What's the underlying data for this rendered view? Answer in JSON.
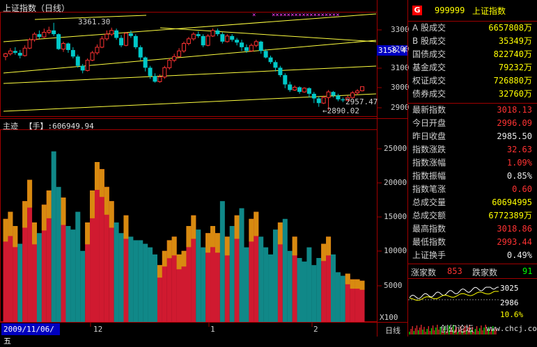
{
  "colors": {
    "up": "#ff3232",
    "down": "#00c8c8",
    "vol_up": "#d01a30",
    "vol_down": "#108888",
    "vol_top": "#d88a10",
    "grid": "#a00000",
    "trend": "#ffff40",
    "marker": "#ff40ff"
  },
  "header": {
    "title": "上证指数（日线）",
    "max_label": "3361.30",
    "current_price": "3158.4",
    "hi_label": "2957.47",
    "lo_label": "←2890.02"
  },
  "volume": {
    "title": "主迹",
    "unit": "【手】",
    "value": ":606949.94",
    "multiplier": "X100"
  },
  "axis": {
    "price_ticks": [
      "3300",
      "3200",
      "3100",
      "3000",
      "2900"
    ],
    "volume_ticks": [
      "25000",
      "20000",
      "15000",
      "10000",
      "5000"
    ],
    "date_label": "2009/11/06/五",
    "month_labels": [
      "12",
      "1",
      "2"
    ],
    "period": "日线"
  },
  "panel": {
    "icon": "G",
    "code": "999999",
    "name": "上证指数",
    "rows1": [
      {
        "label": "A 股成交",
        "value": "6657808万"
      },
      {
        "label": "B 股成交",
        "value": "35349万"
      },
      {
        "label": "国债成交",
        "value": "822740万"
      },
      {
        "label": "基金成交",
        "value": "79232万"
      },
      {
        "label": "权证成交",
        "value": "726880万"
      },
      {
        "label": "债券成交",
        "value": "32760万"
      }
    ],
    "rows2": [
      {
        "label": "最新指数",
        "value": "3018.13",
        "color": "red"
      },
      {
        "label": "今日开盘",
        "value": "2996.09",
        "color": "red"
      },
      {
        "label": "昨日收盘",
        "value": "2985.50",
        "color": "white"
      },
      {
        "label": "指数涨跌",
        "value": "32.63",
        "color": "red"
      },
      {
        "label": "指数涨幅",
        "value": "1.09%",
        "color": "red"
      },
      {
        "label": "指数振幅",
        "value": "0.85%",
        "color": "white"
      },
      {
        "label": "指数笔涨",
        "value": "0.60",
        "color": "red"
      },
      {
        "label": "总成交量",
        "value": "60694995",
        "color": "yellow"
      },
      {
        "label": "总成交额",
        "value": "6772389万",
        "color": "yellow"
      },
      {
        "label": "最高指数",
        "value": "3018.86",
        "color": "red"
      },
      {
        "label": "最低指数",
        "value": "2993.44",
        "color": "red"
      },
      {
        "label": "上证换手",
        "value": "0.49%",
        "color": "white"
      }
    ],
    "up_label": "涨家数",
    "up_count": "853",
    "down_label": "跌家数",
    "down_count": "91",
    "mini_hi": "3025",
    "mini_mid": "2986",
    "mini_pct": "10.6%",
    "watermark": "创幻论坛",
    "site": "www.chcj.com"
  },
  "chart_data": {
    "type": "candlestick",
    "title": "上证指数（日线）",
    "price_ylim": [
      2860,
      3420
    ],
    "volume_ylim": [
      0,
      27000
    ],
    "candles": [
      [
        3180,
        3195,
        3160,
        3200
      ],
      [
        3195,
        3210,
        3185,
        3225
      ],
      [
        3210,
        3200,
        3190,
        3230
      ],
      [
        3200,
        3185,
        3170,
        3215
      ],
      [
        3185,
        3225,
        3180,
        3240
      ],
      [
        3225,
        3270,
        3220,
        3280
      ],
      [
        3270,
        3300,
        3260,
        3310
      ],
      [
        3300,
        3285,
        3275,
        3320
      ],
      [
        3285,
        3310,
        3280,
        3330
      ],
      [
        3310,
        3320,
        3300,
        3340
      ],
      [
        3320,
        3300,
        3290,
        3361
      ],
      [
        3300,
        3220,
        3215,
        3305
      ],
      [
        3220,
        3250,
        3205,
        3260
      ],
      [
        3250,
        3215,
        3200,
        3255
      ],
      [
        3215,
        3180,
        3170,
        3230
      ],
      [
        3180,
        3130,
        3120,
        3190
      ],
      [
        3130,
        3105,
        3090,
        3140
      ],
      [
        3105,
        3160,
        3100,
        3170
      ],
      [
        3160,
        3200,
        3155,
        3210
      ],
      [
        3200,
        3230,
        3190,
        3245
      ],
      [
        3230,
        3275,
        3225,
        3290
      ],
      [
        3275,
        3300,
        3265,
        3320
      ],
      [
        3300,
        3320,
        3290,
        3335
      ],
      [
        3320,
        3280,
        3270,
        3330
      ],
      [
        3280,
        3240,
        3230,
        3295
      ],
      [
        3240,
        3305,
        3235,
        3310
      ],
      [
        3305,
        3290,
        3280,
        3320
      ],
      [
        3290,
        3230,
        3220,
        3300
      ],
      [
        3230,
        3175,
        3160,
        3240
      ],
      [
        3175,
        3120,
        3100,
        3180
      ],
      [
        3120,
        3075,
        3060,
        3130
      ],
      [
        3075,
        3045,
        3040,
        3090
      ],
      [
        3045,
        3070,
        3040,
        3085
      ],
      [
        3070,
        3120,
        3060,
        3130
      ],
      [
        3120,
        3160,
        3110,
        3170
      ],
      [
        3160,
        3180,
        3150,
        3195
      ],
      [
        3180,
        3210,
        3175,
        3225
      ],
      [
        3210,
        3250,
        3200,
        3260
      ],
      [
        3250,
        3275,
        3240,
        3285
      ],
      [
        3275,
        3300,
        3265,
        3310
      ],
      [
        3300,
        3290,
        3280,
        3315
      ],
      [
        3290,
        3240,
        3230,
        3300
      ],
      [
        3240,
        3290,
        3235,
        3300
      ],
      [
        3290,
        3320,
        3285,
        3330
      ],
      [
        3320,
        3300,
        3290,
        3330
      ],
      [
        3300,
        3260,
        3250,
        3310
      ],
      [
        3260,
        3290,
        3255,
        3300
      ],
      [
        3290,
        3270,
        3260,
        3300
      ],
      [
        3270,
        3255,
        3240,
        3280
      ],
      [
        3255,
        3230,
        3210,
        3270
      ],
      [
        3230,
        3210,
        3200,
        3245
      ],
      [
        3210,
        3240,
        3205,
        3250
      ],
      [
        3240,
        3260,
        3230,
        3270
      ],
      [
        3260,
        3210,
        3195,
        3265
      ],
      [
        3210,
        3175,
        3170,
        3220
      ],
      [
        3175,
        3150,
        3140,
        3185
      ],
      [
        3150,
        3120,
        3100,
        3160
      ],
      [
        3120,
        3080,
        3070,
        3130
      ],
      [
        3080,
        3030,
        3010,
        3090
      ],
      [
        3030,
        3000,
        2990,
        3045
      ],
      [
        3000,
        3015,
        2995,
        3025
      ],
      [
        3015,
        2990,
        2980,
        3020
      ],
      [
        2990,
        3010,
        2985,
        3015
      ],
      [
        3010,
        2980,
        2960,
        3015
      ],
      [
        2980,
        2955,
        2930,
        2990
      ],
      [
        2955,
        2930,
        2910,
        2965
      ],
      [
        2930,
        2960,
        2925,
        2970
      ],
      [
        2960,
        2990,
        2890,
        3000
      ],
      [
        2990,
        2970,
        2960,
        2995
      ],
      [
        2970,
        2950,
        2940,
        2980
      ],
      [
        2950,
        2945,
        2935,
        2960
      ],
      [
        2945,
        2960,
        2940,
        2970
      ],
      [
        2960,
        2985,
        2955,
        2995
      ],
      [
        2985,
        2995,
        2975,
        3005
      ],
      [
        2996,
        3018,
        2993,
        3019
      ]
    ],
    "volumes": [
      [
        14500,
        "up"
      ],
      [
        15500,
        "up"
      ],
      [
        13500,
        "up"
      ],
      [
        11000,
        "down"
      ],
      [
        17000,
        "up"
      ],
      [
        20000,
        "up"
      ],
      [
        14000,
        "up"
      ],
      [
        12500,
        "down"
      ],
      [
        16500,
        "up"
      ],
      [
        18500,
        "up"
      ],
      [
        24000,
        "down"
      ],
      [
        19000,
        "down"
      ],
      [
        17500,
        "up"
      ],
      [
        13500,
        "down"
      ],
      [
        13000,
        "down"
      ],
      [
        15500,
        "down"
      ],
      [
        10000,
        "down"
      ],
      [
        14000,
        "up"
      ],
      [
        18500,
        "up"
      ],
      [
        22500,
        "up"
      ],
      [
        21500,
        "up"
      ],
      [
        19000,
        "up"
      ],
      [
        17000,
        "up"
      ],
      [
        14000,
        "down"
      ],
      [
        12500,
        "down"
      ],
      [
        15000,
        "up"
      ],
      [
        12000,
        "down"
      ],
      [
        11500,
        "down"
      ],
      [
        11500,
        "down"
      ],
      [
        11000,
        "down"
      ],
      [
        10500,
        "down"
      ],
      [
        9500,
        "down"
      ],
      [
        8000,
        "up"
      ],
      [
        10000,
        "up"
      ],
      [
        11500,
        "up"
      ],
      [
        12000,
        "up"
      ],
      [
        9500,
        "up"
      ],
      [
        10000,
        "up"
      ],
      [
        13500,
        "up"
      ],
      [
        15000,
        "up"
      ],
      [
        13000,
        "down"
      ],
      [
        10500,
        "down"
      ],
      [
        12500,
        "up"
      ],
      [
        13500,
        "up"
      ],
      [
        12500,
        "up"
      ],
      [
        17000,
        "down"
      ],
      [
        12000,
        "up"
      ],
      [
        13500,
        "down"
      ],
      [
        15000,
        "up"
      ],
      [
        16000,
        "down"
      ],
      [
        10500,
        "down"
      ],
      [
        14500,
        "up"
      ],
      [
        15500,
        "up"
      ],
      [
        12000,
        "down"
      ],
      [
        10500,
        "down"
      ],
      [
        9500,
        "down"
      ],
      [
        13000,
        "down"
      ],
      [
        14000,
        "up"
      ],
      [
        14500,
        "down"
      ],
      [
        10000,
        "down"
      ],
      [
        12000,
        "up"
      ],
      [
        9000,
        "down"
      ],
      [
        8500,
        "down"
      ],
      [
        10500,
        "down"
      ],
      [
        8000,
        "down"
      ],
      [
        9000,
        "down"
      ],
      [
        11000,
        "up"
      ],
      [
        12000,
        "up"
      ],
      [
        9500,
        "down"
      ],
      [
        7000,
        "down"
      ],
      [
        6500,
        "down"
      ],
      [
        6800,
        "up"
      ],
      [
        6000,
        "up"
      ],
      [
        6000,
        "up"
      ],
      [
        5800,
        "up"
      ]
    ]
  }
}
